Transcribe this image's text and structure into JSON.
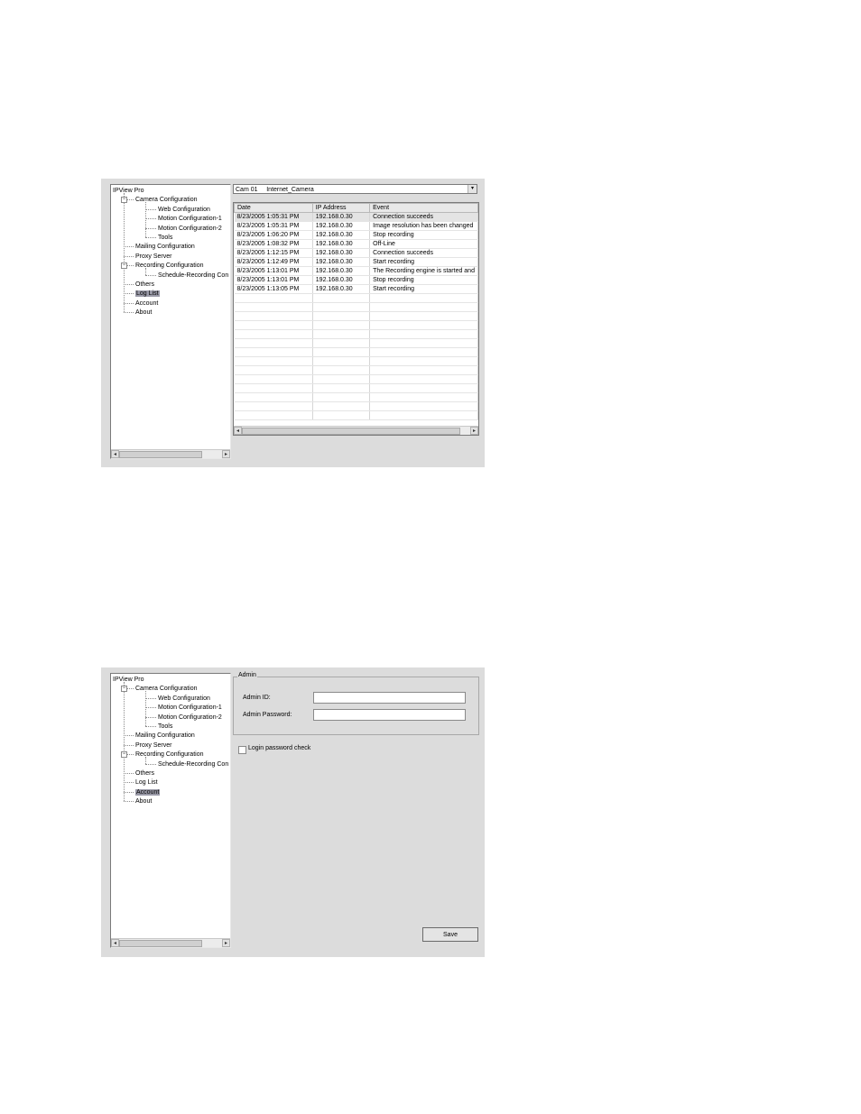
{
  "tree": {
    "root": "IPView Pro",
    "camera_configuration": "Camera Configuration",
    "web_configuration": "Web Configuration",
    "motion_configuration_1": "Motion Configuration-1",
    "motion_configuration_2": "Motion Configuration-2",
    "tools": "Tools",
    "mailing_configuration": "Mailing Configuration",
    "proxy_server": "Proxy Server",
    "recording_configuration": "Recording Configuration",
    "schedule_recording": "Schedule-Recording Con",
    "others": "Others",
    "log_list": "Log List",
    "account": "Account",
    "about": "About"
  },
  "log_screen": {
    "camera_select": "Cam 01     Internet_Camera",
    "columns": [
      "Date",
      "IP Address",
      "Event"
    ],
    "rows": [
      [
        "8/23/2005 1:05:31 PM",
        "192.168.0.30",
        "Connection succeeds"
      ],
      [
        "8/23/2005 1:05:31 PM",
        "192.168.0.30",
        "Image resolution has been changed"
      ],
      [
        "8/23/2005 1:06:20 PM",
        "192.168.0.30",
        "Stop recording"
      ],
      [
        "8/23/2005 1:08:32 PM",
        "192.168.0.30",
        "Off-Line"
      ],
      [
        "8/23/2005 1:12:15 PM",
        "192.168.0.30",
        "Connection succeeds"
      ],
      [
        "8/23/2005 1:12:49 PM",
        "192.168.0.30",
        "Start recording"
      ],
      [
        "8/23/2005 1:13:01 PM",
        "192.168.0.30",
        "The Recording engine is started and"
      ],
      [
        "8/23/2005 1:13:01 PM",
        "192.168.0.30",
        "Stop recording"
      ],
      [
        "8/23/2005 1:13:05 PM",
        "192.168.0.30",
        "Start recording"
      ]
    ],
    "selected_tree_item": "Log List"
  },
  "account_screen": {
    "group_title": "Admin",
    "admin_id_label": "Admin ID:",
    "admin_id_value": "",
    "admin_password_label": "Admin Password:",
    "admin_password_value": "",
    "login_check_label": "Login password check",
    "login_check_checked": false,
    "save_label": "Save",
    "selected_tree_item": "Account"
  }
}
